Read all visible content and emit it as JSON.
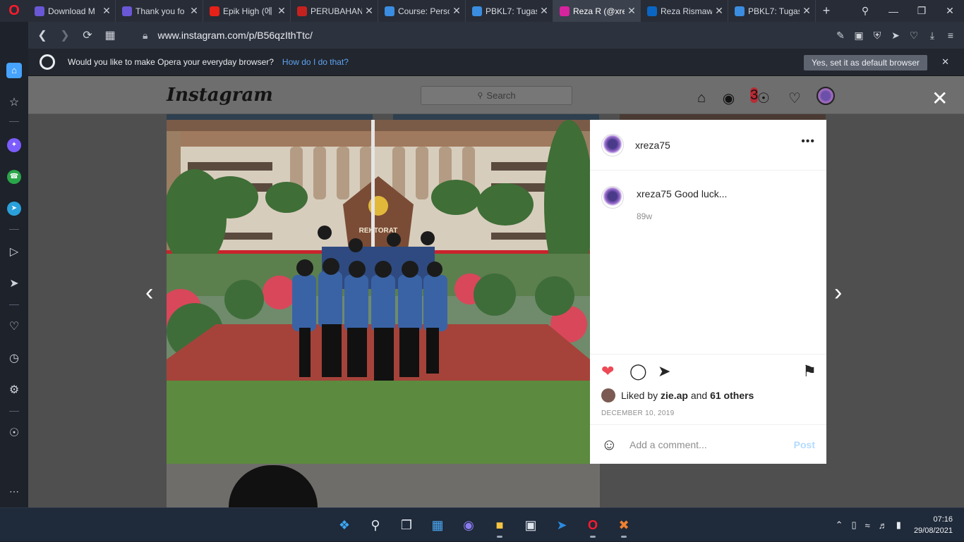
{
  "browser": {
    "tabs": [
      {
        "label": "Download M",
        "icon_color": "#6a57d6"
      },
      {
        "label": "Thank you fo",
        "icon_color": "#6a57d6"
      },
      {
        "label": "Epik High (에",
        "icon_color": "#e62117"
      },
      {
        "label": "PERUBAHAN",
        "icon_color": "#c5221f"
      },
      {
        "label": "Course: Perso",
        "icon_color": "#3a8de0"
      },
      {
        "label": "PBKL7: Tugas",
        "icon_color": "#3a8de0"
      },
      {
        "label": "Reza R (@xre",
        "icon_color": "#d6249f"
      },
      {
        "label": "Reza Rismaw",
        "icon_color": "#0a66c2"
      },
      {
        "label": "PBKL7: Tugas",
        "icon_color": "#3a8de0"
      }
    ],
    "url": "www.instagram.com/p/B56qzIthTtc/",
    "infobar": {
      "message": "Would you like to make Opera your everyday browser?",
      "link": "How do I do that?",
      "button": "Yes, set it as default browser"
    }
  },
  "instagram": {
    "logo": "Instagram",
    "search_placeholder": "Search",
    "notification_count": "3",
    "post": {
      "username": "xreza75",
      "caption": "Good luck...",
      "age": "89w",
      "liked_by_user": "zie.ap",
      "liked_others": "61 others",
      "liked_prefix": "Liked by",
      "liked_and": "and",
      "date": "DECEMBER 10, 2019",
      "comment_placeholder": "Add a comment...",
      "post_button": "Post",
      "photo_sign": "REKTORAT"
    }
  },
  "taskbar": {
    "time": "07:16",
    "date": "29/08/2021"
  }
}
